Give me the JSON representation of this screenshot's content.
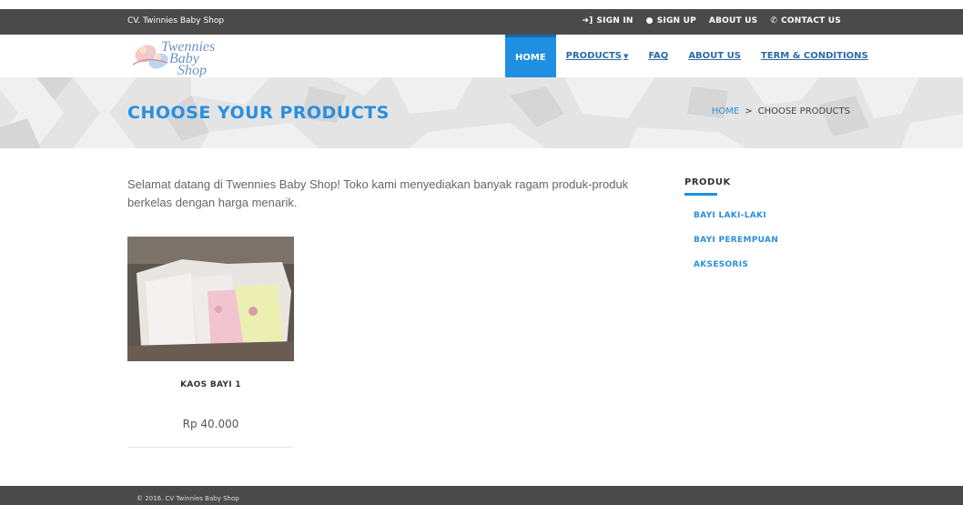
{
  "topbar": {
    "brand": "CV. Twinnies Baby Shop",
    "links": [
      {
        "label": "SIGN IN",
        "icon": "sign-in-icon"
      },
      {
        "label": "SIGN UP",
        "icon": "user-icon"
      },
      {
        "label": "ABOUT US",
        "icon": ""
      },
      {
        "label": "CONTACT US",
        "icon": "phone-icon"
      }
    ]
  },
  "logo": {
    "line1": "Twennies",
    "line2": "Baby",
    "line3": "Shop"
  },
  "nav": {
    "items": [
      "HOME",
      "PRODUCTS",
      "FAQ",
      "ABOUT US",
      "TERM & CONDITIONS"
    ],
    "active": "HOME"
  },
  "banner": {
    "title": "CHOOSE YOUR PRODUCTS",
    "crumb_home": "HOME",
    "crumb_sep": ">",
    "crumb_current": "CHOOSE PRODUCTS"
  },
  "main": {
    "intro": "Selamat datang di Twennies Baby Shop! Toko kami menyediakan banyak ragam produk-produk berkelas dengan harga menarik.",
    "products": [
      {
        "name": "KAOS BAYI 1",
        "price": "Rp 40.000"
      }
    ]
  },
  "sidebar": {
    "heading": "PRODUK",
    "items": [
      "BAYI LAKI-LAKI",
      "BAYI PEREMPUAN",
      "AKSESORIS"
    ]
  },
  "footer": {
    "text": "© 2016. CV Twinnies Baby Shop"
  },
  "colors": {
    "accent": "#1e8fe1",
    "dark_bar": "#4a4a4a",
    "link": "#2c6aa6"
  }
}
